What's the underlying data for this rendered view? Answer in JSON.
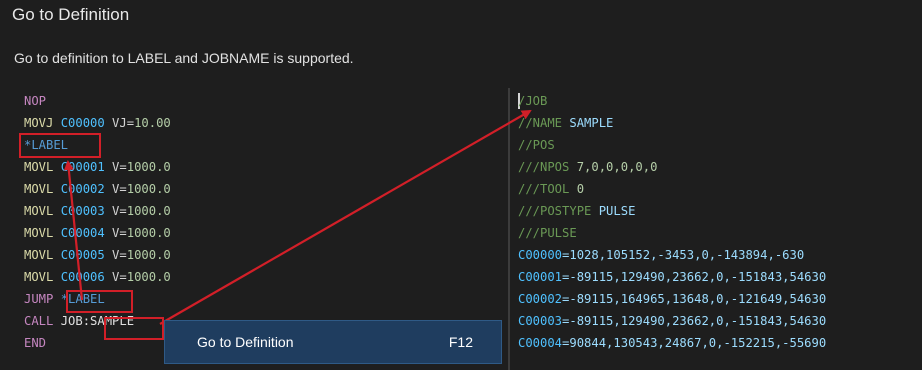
{
  "title": "Go to Definition",
  "description": "Go to definition to LABEL and JOBNAME is supported.",
  "left_code": [
    [
      {
        "t": "NOP",
        "c": "kw"
      }
    ],
    [
      {
        "t": "MOVJ ",
        "c": "fn"
      },
      {
        "t": "C00000",
        "c": "var"
      },
      {
        "t": " VJ=",
        "c": "eq"
      },
      {
        "t": "10.00",
        "c": "num"
      }
    ],
    [
      {
        "t": "*LABEL",
        "c": "label"
      }
    ],
    [
      {
        "t": "MOVL ",
        "c": "fn"
      },
      {
        "t": "C00001",
        "c": "var"
      },
      {
        "t": " V=",
        "c": "eq"
      },
      {
        "t": "1000.0",
        "c": "num"
      }
    ],
    [
      {
        "t": "MOVL ",
        "c": "fn"
      },
      {
        "t": "C00002",
        "c": "var"
      },
      {
        "t": " V=",
        "c": "eq"
      },
      {
        "t": "1000.0",
        "c": "num"
      }
    ],
    [
      {
        "t": "MOVL ",
        "c": "fn"
      },
      {
        "t": "C00003",
        "c": "var"
      },
      {
        "t": " V=",
        "c": "eq"
      },
      {
        "t": "1000.0",
        "c": "num"
      }
    ],
    [
      {
        "t": "MOVL ",
        "c": "fn"
      },
      {
        "t": "C00004",
        "c": "var"
      },
      {
        "t": " V=",
        "c": "eq"
      },
      {
        "t": "1000.0",
        "c": "num"
      }
    ],
    [
      {
        "t": "MOVL ",
        "c": "fn"
      },
      {
        "t": "C00005",
        "c": "var"
      },
      {
        "t": " V=",
        "c": "eq"
      },
      {
        "t": "1000.0",
        "c": "num"
      }
    ],
    [
      {
        "t": "MOVL ",
        "c": "fn"
      },
      {
        "t": "C00006",
        "c": "var"
      },
      {
        "t": " V=",
        "c": "eq"
      },
      {
        "t": "1000.0",
        "c": "num"
      }
    ],
    [
      {
        "t": "JUMP ",
        "c": "kw"
      },
      {
        "t": "*LABEL",
        "c": "label"
      }
    ],
    [
      {
        "t": "CALL ",
        "c": "kw"
      },
      {
        "t": "JOB:",
        "c": "white"
      },
      {
        "t": "SAMPLE",
        "c": "white"
      }
    ],
    [
      {
        "t": "END",
        "c": "kw"
      }
    ]
  ],
  "right_code": [
    [
      {
        "t": "/JOB",
        "c": "cmt"
      }
    ],
    [
      {
        "t": "//NAME ",
        "c": "cmt"
      },
      {
        "t": "SAMPLE",
        "c": "name"
      }
    ],
    [
      {
        "t": "//POS",
        "c": "cmt"
      }
    ],
    [
      {
        "t": "///NPOS ",
        "c": "cmt"
      },
      {
        "t": "7,0,0,0,0,0",
        "c": "num"
      }
    ],
    [
      {
        "t": "///TOOL ",
        "c": "cmt"
      },
      {
        "t": "0",
        "c": "num"
      }
    ],
    [
      {
        "t": "///POSTYPE ",
        "c": "cmt"
      },
      {
        "t": "PULSE",
        "c": "name"
      }
    ],
    [
      {
        "t": "///PULSE",
        "c": "cmt"
      }
    ],
    [
      {
        "t": "C00000",
        "c": "var"
      },
      {
        "t": "=1028,105152,-3453,0,-143894,-630",
        "c": "pos-val"
      }
    ],
    [
      {
        "t": "C00001",
        "c": "var"
      },
      {
        "t": "=-89115,129490,23662,0,-151843,54630",
        "c": "pos-val"
      }
    ],
    [
      {
        "t": "C00002",
        "c": "var"
      },
      {
        "t": "=-89115,164965,13648,0,-121649,54630",
        "c": "pos-val"
      }
    ],
    [
      {
        "t": "C00003",
        "c": "var"
      },
      {
        "t": "=-89115,129490,23662,0,-151843,54630",
        "c": "pos-val"
      }
    ],
    [
      {
        "t": "C00004",
        "c": "var"
      },
      {
        "t": "=90844,130543,24867,0,-152215,-55690",
        "c": "pos-val"
      }
    ]
  ],
  "context_menu": {
    "label": "Go to Definition",
    "shortcut": "F12"
  },
  "colors": {
    "highlight_box": "#d21f28",
    "menu_bg": "#1f3d5f"
  }
}
